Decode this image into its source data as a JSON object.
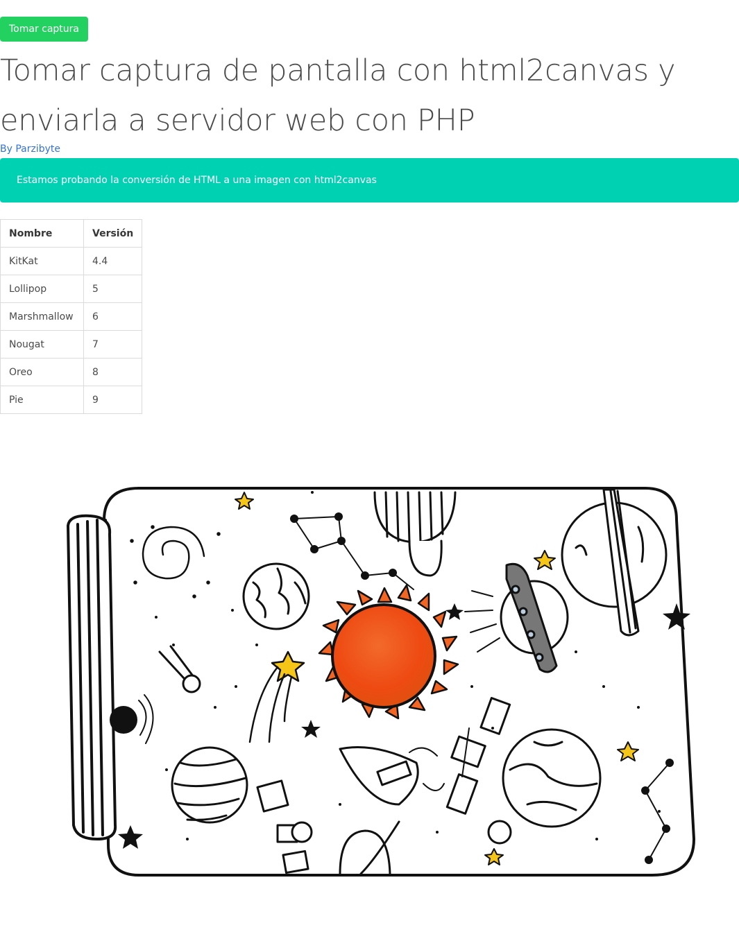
{
  "toolbar": {
    "capture_label": "Tomar captura"
  },
  "page": {
    "title": "Tomar captura de pantalla con html2canvas y enviarla a servidor web con PHP",
    "author_link": "By Parzibyte"
  },
  "notice": {
    "text": "Estamos probando la conversión de HTML a una imagen con html2canvas"
  },
  "table": {
    "headers": [
      "Nombre",
      "Versión"
    ],
    "rows": [
      [
        "KitKat",
        "4.4"
      ],
      [
        "Lollipop",
        "5"
      ],
      [
        "Marshmallow",
        "6"
      ],
      [
        "Nougat",
        "7"
      ],
      [
        "Oreo",
        "8"
      ],
      [
        "Pie",
        "9"
      ]
    ]
  },
  "colors": {
    "button": "#23d160",
    "notification": "#00d1b2",
    "link": "#3273dc",
    "text": "#4a4a4a",
    "sun": "#ee4a12",
    "sun_rays": "#f26522",
    "stars": "#f5c518"
  },
  "illustration": {
    "icon": "space-jar-illustration"
  }
}
